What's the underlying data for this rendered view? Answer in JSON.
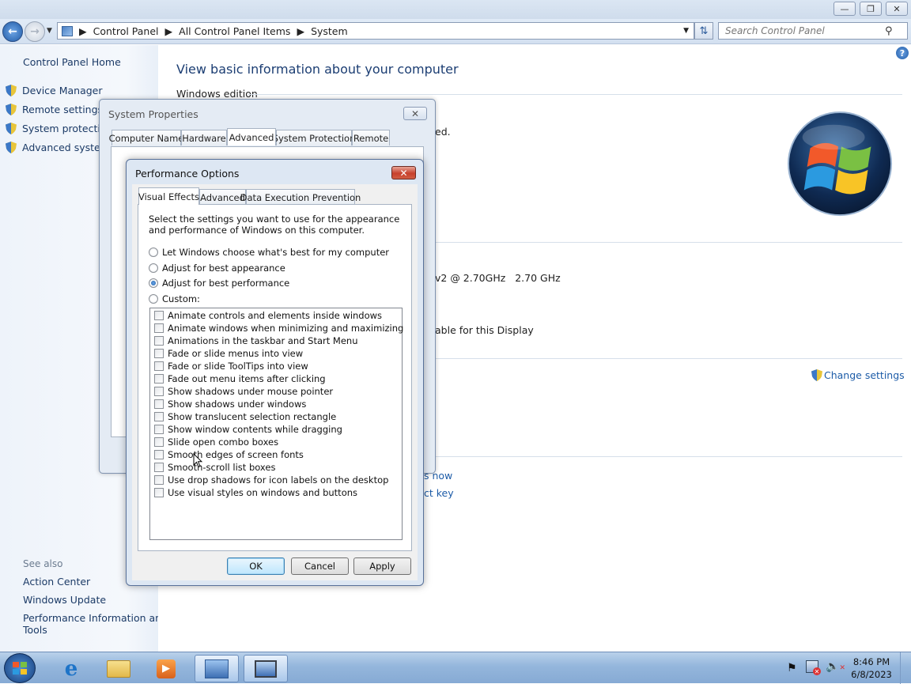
{
  "window": {
    "caption_buttons": [
      "minimize",
      "restore",
      "close"
    ],
    "breadcrumb": [
      "Control Panel",
      "All Control Panel Items",
      "System"
    ],
    "search_placeholder": "Search Control Panel"
  },
  "left_pane": {
    "home": "Control Panel Home",
    "tasks": [
      {
        "label": "Device Manager",
        "icon": "uac-shield-icon"
      },
      {
        "label": "Remote settings",
        "icon": "uac-shield-icon"
      },
      {
        "label": "System protection",
        "icon": "uac-shield-icon"
      },
      {
        "label": "Advanced system",
        "icon": "uac-shield-icon"
      }
    ],
    "see_also_heading": "See also",
    "see_also": [
      "Action Center",
      "Windows Update",
      "Performance Information and",
      "Tools"
    ]
  },
  "main": {
    "heading": "View basic information about your computer",
    "section_edition": "Windows edition",
    "fragment_ed": "ed.",
    "processor_fragment": "v2 @ 2.70GHz   2.70 GHz",
    "display_fragment": "able for this Display",
    "change_settings": "Change settings",
    "now_fragment": "s now",
    "key_fragment": "ct key"
  },
  "system_properties": {
    "title": "System Properties",
    "tabs": [
      "Computer Name",
      "Hardware",
      "Advanced",
      "System Protection",
      "Remote"
    ],
    "active_tab": "Advanced"
  },
  "performance_options": {
    "title": "Performance Options",
    "tabs": [
      "Visual Effects",
      "Advanced",
      "Data Execution Prevention"
    ],
    "active_tab": "Visual Effects",
    "description": "Select the settings you want to use for the appearance and performance of Windows on this computer.",
    "radios": [
      {
        "label": "Let Windows choose what's best for my computer",
        "checked": false
      },
      {
        "label": "Adjust for best appearance",
        "checked": false
      },
      {
        "label": "Adjust for best performance",
        "checked": true
      },
      {
        "label": "Custom:",
        "checked": false
      }
    ],
    "effects": [
      "Animate controls and elements inside windows",
      "Animate windows when minimizing and maximizing",
      "Animations in the taskbar and Start Menu",
      "Fade or slide menus into view",
      "Fade or slide ToolTips into view",
      "Fade out menu items after clicking",
      "Show shadows under mouse pointer",
      "Show shadows under windows",
      "Show translucent selection rectangle",
      "Show window contents while dragging",
      "Slide open combo boxes",
      "Smooth edges of screen fonts",
      "Smooth-scroll list boxes",
      "Use drop shadows for icon labels on the desktop",
      "Use visual styles on windows and buttons"
    ],
    "effects_checked": [
      false,
      false,
      false,
      false,
      false,
      false,
      false,
      false,
      false,
      false,
      false,
      false,
      false,
      false,
      false
    ],
    "buttons": {
      "ok": "OK",
      "cancel": "Cancel",
      "apply": "Apply"
    }
  },
  "taskbar": {
    "items": [
      "start-orb",
      "internet-explorer",
      "windows-explorer",
      "media-player",
      "control-panel",
      "remote-desktop"
    ],
    "time": "8:46 PM",
    "date": "6/8/2023"
  }
}
